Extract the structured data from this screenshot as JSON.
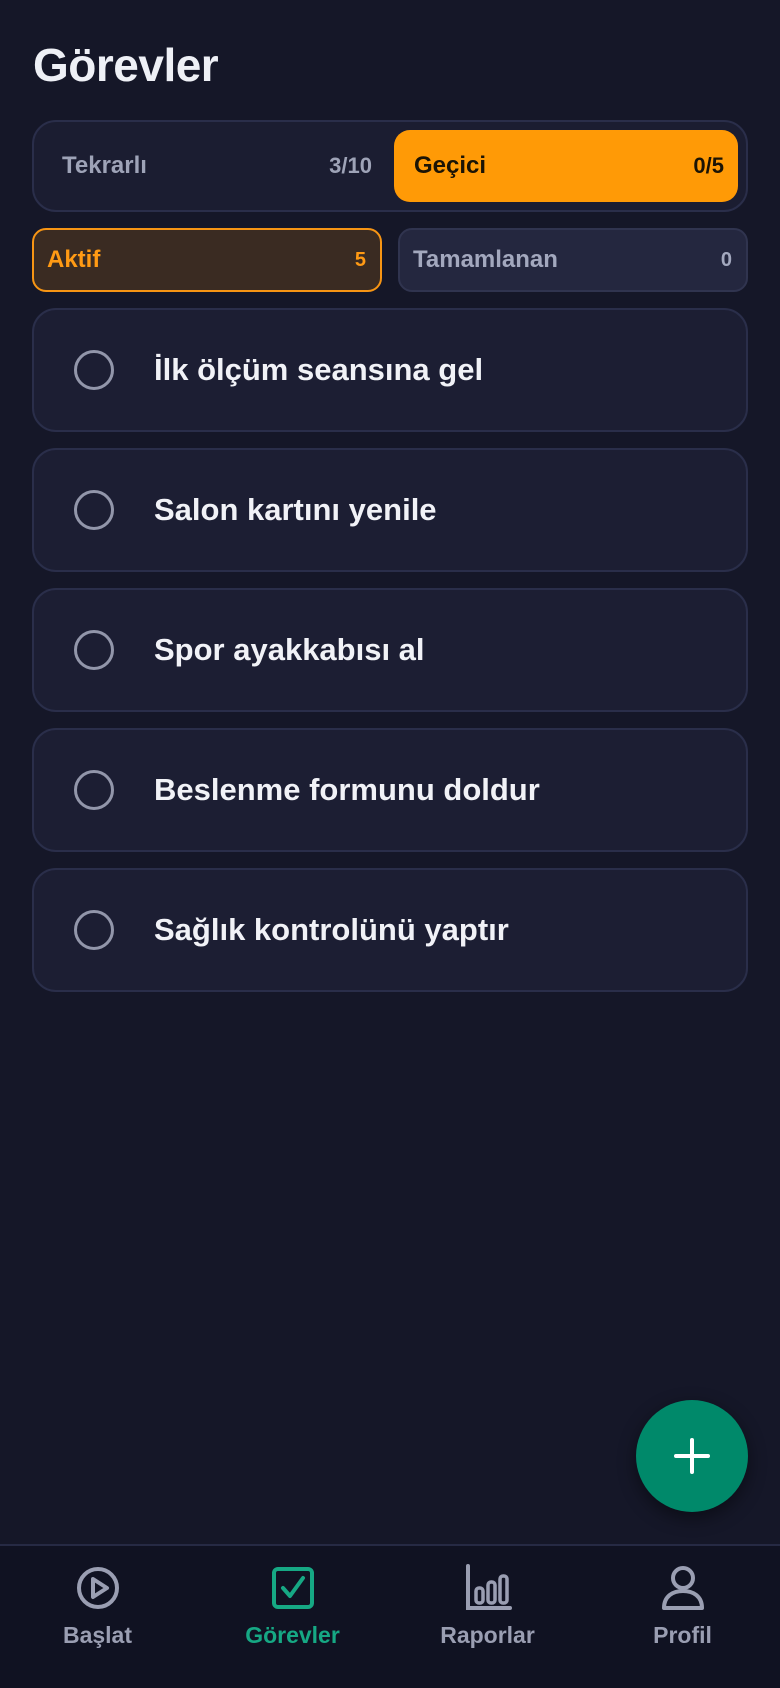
{
  "header": {
    "title": "Görevler"
  },
  "segment": {
    "tabs": [
      {
        "label": "Tekrarlı",
        "count": "3/10",
        "active": false
      },
      {
        "label": "Geçici",
        "count": "0/5",
        "active": true
      }
    ]
  },
  "filters": [
    {
      "label": "Aktif",
      "count": "5",
      "active": true
    },
    {
      "label": "Tamamlanan",
      "count": "0",
      "active": false
    }
  ],
  "tasks": [
    {
      "label": "İlk ölçüm seansına gel",
      "done": false
    },
    {
      "label": "Salon kartını yenile",
      "done": false
    },
    {
      "label": "Spor ayakkabısı al",
      "done": false
    },
    {
      "label": "Beslenme formunu doldur",
      "done": false
    },
    {
      "label": "Sağlık kontrolünü yaptır",
      "done": false
    }
  ],
  "fab": {
    "icon": "plus-icon"
  },
  "tabbar": {
    "items": [
      {
        "label": "Başlat",
        "icon": "play-circle-icon",
        "active": false
      },
      {
        "label": "Görevler",
        "icon": "checkbox-icon",
        "active": true
      },
      {
        "label": "Raporlar",
        "icon": "bar-chart-icon",
        "active": false
      },
      {
        "label": "Profil",
        "icon": "user-icon",
        "active": false
      }
    ]
  },
  "colors": {
    "background": "#151728",
    "accent": "#FF9A06",
    "primary_green": "#00896A",
    "active_tab": "#16A884"
  }
}
